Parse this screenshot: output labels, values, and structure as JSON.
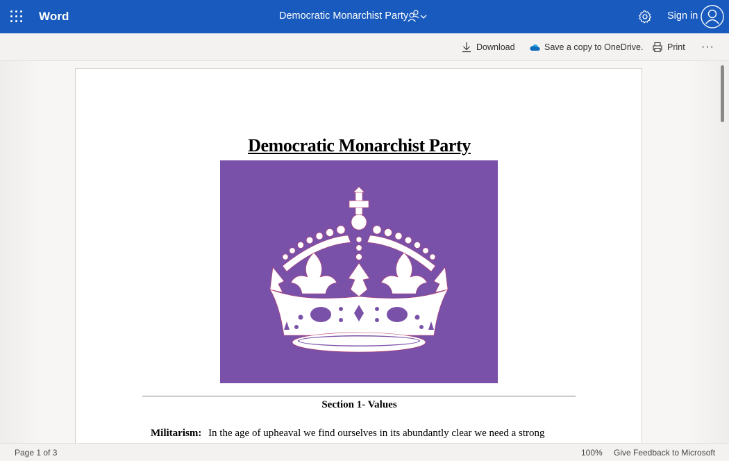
{
  "topbar": {
    "app_name": "Word",
    "document_title": "Democratic Monarchist Party",
    "sign_in_label": "Sign in",
    "icons": [
      "app-launcher-icon",
      "share-people-icon",
      "chevron-down-icon",
      "settings-gear-icon",
      "user-avatar-icon"
    ],
    "background_color": "#185abd"
  },
  "commandbar": {
    "download_label": "Download",
    "save_copy_label": "Save a copy to OneDrive.",
    "print_label": "Print",
    "more_label": "···"
  },
  "document": {
    "title": "Democratic Monarchist Party",
    "image": {
      "description_icon": "crown-icon",
      "background_color": "#7a51a8"
    },
    "section_heading": "Section 1- Values",
    "paragraph_label": "Militarism:",
    "paragraph_text": "In the age of upheaval we find ourselves in its abundantly clear we need a strong"
  },
  "statusbar": {
    "page_indicator": "Page 1 of 3",
    "zoom": "100%",
    "feedback_label": "Give Feedback to Microsoft"
  }
}
